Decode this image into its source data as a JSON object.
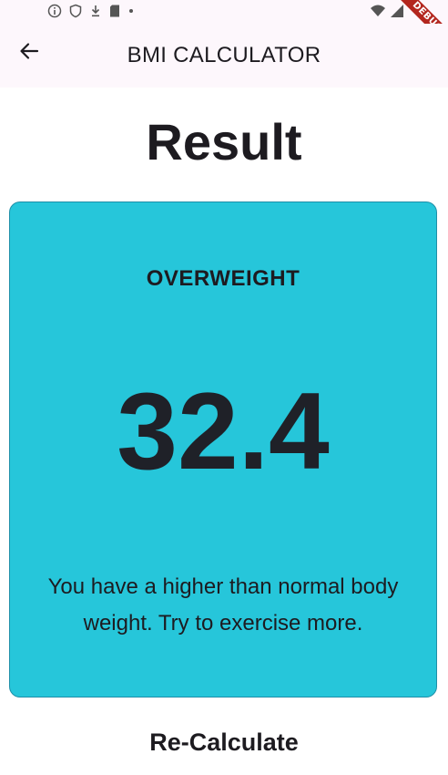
{
  "status_bar": {
    "icons": [
      "info-icon",
      "shield-icon",
      "download-icon",
      "sd-card-icon",
      "dot-icon",
      "wifi-icon",
      "signal-icon"
    ]
  },
  "debug_banner": {
    "label": "DEBUG"
  },
  "app_bar": {
    "back_icon": "arrow-back-icon",
    "title": "BMI CALCULATOR"
  },
  "page": {
    "title": "Result"
  },
  "result": {
    "category": "OVERWEIGHT",
    "bmi": "32.4",
    "message": "You have a higher than normal body weight. Try to exercise more.",
    "card_color": "#26c6da"
  },
  "actions": {
    "recalculate_label": "Re-Calculate"
  }
}
